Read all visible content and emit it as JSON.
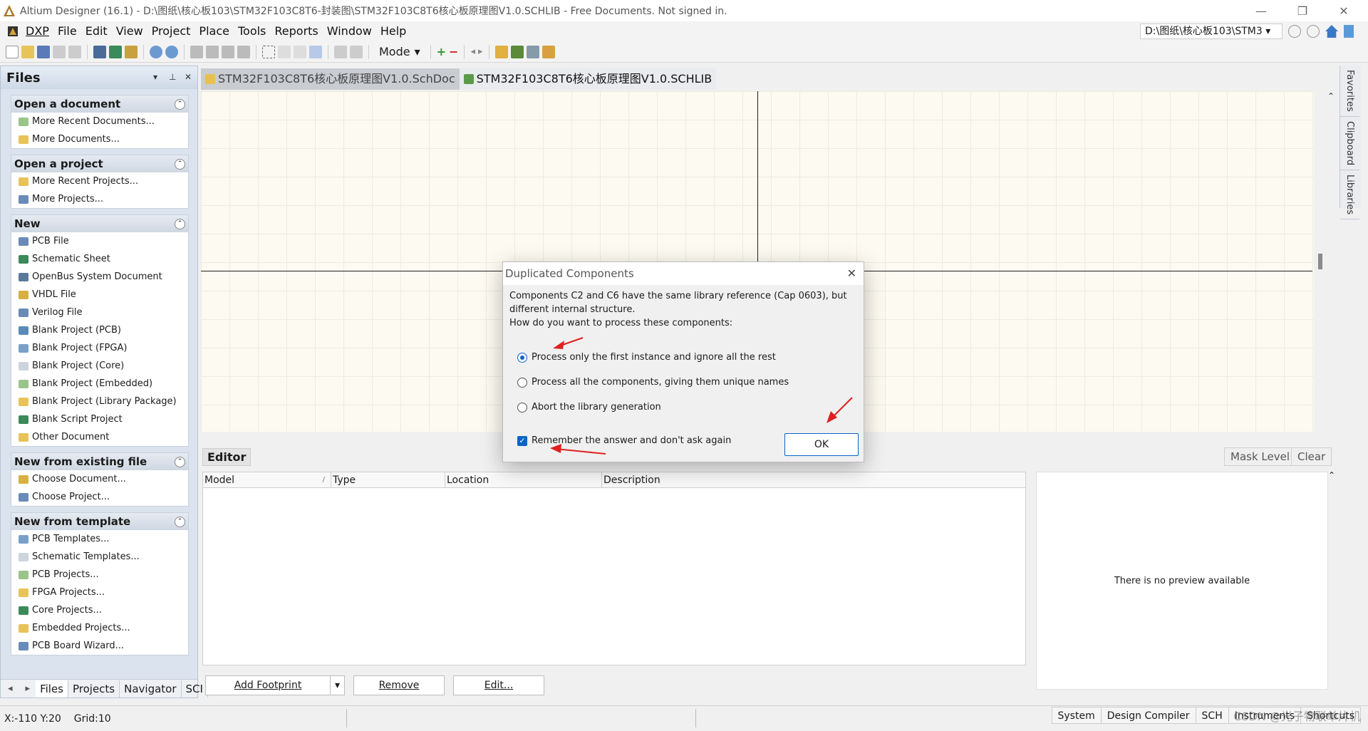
{
  "window": {
    "title": "Altium Designer (16.1) - D:\\图纸\\核心板103\\STM32F103C8T6-封装图\\STM32F103C8T6核心板原理图V1.0.SCHLIB - Free Documents. Not signed in.",
    "minimize": "—",
    "restore": "❐",
    "close": "✕"
  },
  "menu": {
    "items": [
      {
        "label": "DXP"
      },
      {
        "label": "File"
      },
      {
        "label": "Edit"
      },
      {
        "label": "View"
      },
      {
        "label": "Project"
      },
      {
        "label": "Place"
      },
      {
        "label": "Tools"
      },
      {
        "label": "Reports"
      },
      {
        "label": "Window"
      },
      {
        "label": "Help"
      }
    ],
    "path": "D:\\图纸\\核心板103\\STM3"
  },
  "toolbar": {
    "mode_label": "Mode"
  },
  "files_panel": {
    "title": "Files",
    "groups": [
      {
        "title": "Open a document",
        "items": [
          "More Recent Documents...",
          "More Documents..."
        ]
      },
      {
        "title": "Open a project",
        "items": [
          "More Recent Projects...",
          "More Projects..."
        ]
      },
      {
        "title": "New",
        "items": [
          "PCB File",
          "Schematic Sheet",
          "OpenBus System Document",
          "VHDL File",
          "Verilog File",
          "Blank Project (PCB)",
          "Blank Project (FPGA)",
          "Blank Project (Core)",
          "Blank Project (Embedded)",
          "Blank Project (Library Package)",
          "Blank Script Project",
          "Other Document"
        ]
      },
      {
        "title": "New from existing file",
        "items": [
          "Choose Document...",
          "Choose Project..."
        ]
      },
      {
        "title": "New from template",
        "items": [
          "PCB Templates...",
          "Schematic Templates...",
          "PCB Projects...",
          "FPGA Projects...",
          "Core Projects...",
          "Embedded Projects...",
          "PCB Board Wizard..."
        ]
      }
    ],
    "tabs": [
      "Files",
      "Projects",
      "Navigator",
      "SCI"
    ]
  },
  "doc_tabs": [
    {
      "label": "STM32F103C8T6核心板原理图V1.0.SchDoc"
    },
    {
      "label": "STM32F103C8T6核心板原理图V1.0.SCHLIB"
    }
  ],
  "right_panel_tabs": [
    "Favorites",
    "Clipboard",
    "Libraries"
  ],
  "editor": {
    "label": "Editor",
    "mask_level": "Mask Level",
    "clear": "Clear",
    "columns": [
      "Model",
      "Type",
      "Location",
      "Description"
    ],
    "sort_mark": "/",
    "preview_text": "There is no preview available",
    "add_footprint": "Add Footprint",
    "remove": "Remove",
    "edit": "Edit..."
  },
  "status": {
    "coords": "X:-110 Y:20",
    "grid": "Grid:10",
    "tabs": [
      "System",
      "Design Compiler",
      "SCH",
      "Instruments",
      "Shortcuts"
    ],
    "watermark": "CSDN @光子物联单片机"
  },
  "dialog": {
    "title": "Duplicated Components",
    "message_line1": "Components C2 and C6 have the same library reference (Cap 0603), but",
    "message_line2": "different internal structure.",
    "message_line3": "How do you want to process these components:",
    "options": [
      {
        "label": "Process only the first instance and ignore all the rest",
        "checked": true
      },
      {
        "label": "Process all the components, giving them unique names",
        "checked": false
      },
      {
        "label": "Abort the library generation",
        "checked": false
      }
    ],
    "remember_label": "Remember the answer and don't ask again",
    "remember_checked": true,
    "ok_label": "OK"
  },
  "colors": {
    "accent": "#0a64c8",
    "annotation_arrow": "#e02020",
    "canvas_bg": "#fdfaf1"
  }
}
